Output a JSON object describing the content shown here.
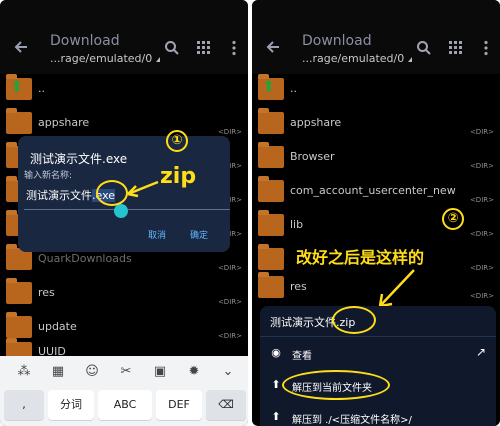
{
  "left": {
    "appbar": {
      "title": "Download",
      "path": "...rage/emulated/0"
    },
    "files": [
      {
        "name": "..",
        "dir": "",
        "up": true
      },
      {
        "name": "appshare",
        "dir": "<DIR>"
      },
      {
        "name": "",
        "dir": "<DIR>"
      },
      {
        "name": "",
        "dir": "<DIR>"
      },
      {
        "name": "",
        "dir": "<DIR>"
      },
      {
        "name": "QuarkDownloads",
        "dir": "<DIR>"
      },
      {
        "name": "res",
        "dir": "<DIR>"
      },
      {
        "name": "update",
        "dir": "<DIR>"
      },
      {
        "name": "UUID",
        "dir": ""
      }
    ],
    "dialog": {
      "title": "测试演示文件.exe",
      "label": "输入新名称:",
      "input_value_main": "测试演示文件",
      "input_value_ext": ".exe",
      "cancel": "取消",
      "ok": "确定"
    },
    "annotation": {
      "number": "①",
      "text": "zip"
    },
    "keyboard": {
      "keys": [
        ",",
        "分词",
        "ABC",
        "DEF",
        "⌫"
      ]
    }
  },
  "right": {
    "appbar": {
      "title": "Download",
      "path": "...rage/emulated/0"
    },
    "files": [
      {
        "name": "..",
        "dir": "",
        "up": true
      },
      {
        "name": "appshare",
        "dir": "<DIR>"
      },
      {
        "name": "Browser",
        "dir": "<DIR>"
      },
      {
        "name": "com_account_usercenter_new",
        "dir": "<DIR>"
      },
      {
        "name": "lib",
        "dir": "<DIR>"
      },
      {
        "name": "",
        "dir": "<DIR>"
      },
      {
        "name": "res",
        "dir": "<DIR>"
      }
    ],
    "annotation": {
      "number": "②",
      "text": "改好之后是这样的"
    },
    "menu": {
      "file": "测试演示文件.zip",
      "items": [
        {
          "label": "查看",
          "icon": "eye-icon"
        },
        {
          "label": "解压到当前文件夹",
          "icon": "upload-icon"
        },
        {
          "label": "解压到 ./<压缩文件名称>/",
          "icon": "upload-icon"
        }
      ]
    }
  },
  "colors": {
    "accent": "#ffde17",
    "link": "#5fb8ff",
    "dialog_bg": "#1a2740",
    "folder": "#b8661e"
  }
}
